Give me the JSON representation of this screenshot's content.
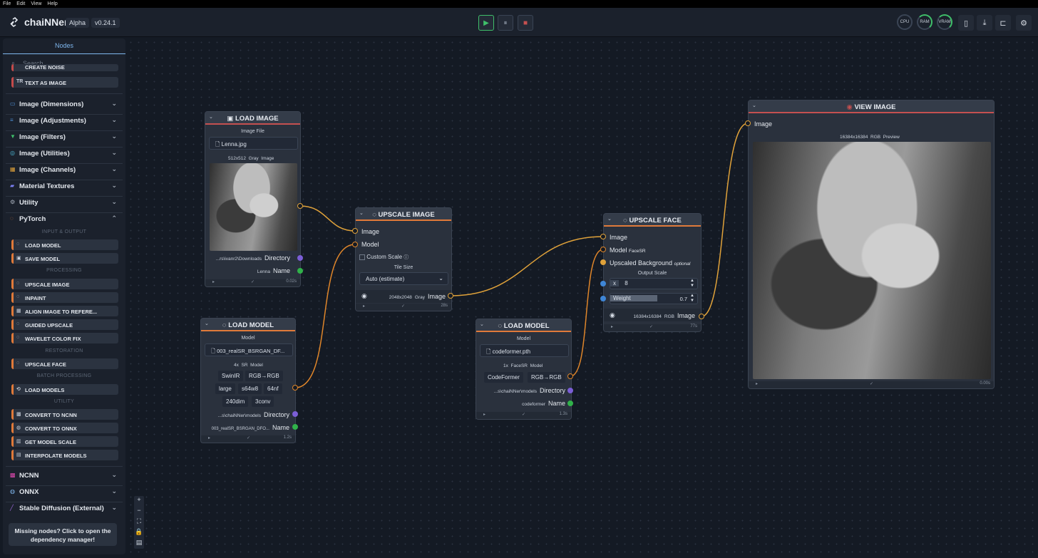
{
  "menubar": [
    "File",
    "Edit",
    "View",
    "Help"
  ],
  "app": {
    "title": "chaiNNer",
    "channel": "Alpha",
    "version": "v0.24.1"
  },
  "toolbar": {
    "run": "▶",
    "pause": "⏸",
    "stop": "■",
    "gauges": [
      "CPU",
      "RAM",
      "VRAM"
    ],
    "icons": [
      "bookmark-icon",
      "download-icon",
      "dependency-icon",
      "gear-icon"
    ]
  },
  "sidebar": {
    "tab": "Nodes",
    "search_placeholder": "Search...",
    "top_nodes": [
      "CREATE NOISE",
      "TEXT AS IMAGE"
    ],
    "categories": [
      {
        "label": "Image (Dimensions)",
        "icon": "▭",
        "color": "#4d8fd6"
      },
      {
        "label": "Image (Adjustments)",
        "icon": "≡",
        "color": "#4d8fd6"
      },
      {
        "label": "Image (Filters)",
        "icon": "▼",
        "color": "#3fbf6a"
      },
      {
        "label": "Image (Utilities)",
        "icon": "◎",
        "color": "#4db8d6"
      },
      {
        "label": "Image (Channels)",
        "icon": "▦",
        "color": "#e0a23a"
      },
      {
        "label": "Material Textures",
        "icon": "▰",
        "color": "#7b7ff0"
      },
      {
        "label": "Utility",
        "icon": "⚙",
        "color": "#aab2be"
      },
      {
        "label": "PyTorch",
        "icon": "◌",
        "color": "#e07a3a"
      }
    ],
    "pytorch": {
      "input_output": "INPUT & OUTPUT",
      "io_nodes": [
        "LOAD MODEL",
        "SAVE MODEL"
      ],
      "processing": "PROCESSING",
      "proc_nodes": [
        "UPSCALE IMAGE",
        "INPAINT",
        "ALIGN IMAGE TO REFERE...",
        "GUIDED UPSCALE",
        "WAVELET COLOR FIX"
      ],
      "restoration": "RESTORATION",
      "rest_nodes": [
        "UPSCALE FACE"
      ],
      "batch": "BATCH PROCESSING",
      "batch_nodes": [
        "LOAD MODELS"
      ],
      "utility": "UTILITY",
      "util_nodes": [
        "CONVERT TO NCNN",
        "CONVERT TO ONNX",
        "GET MODEL SCALE",
        "INTERPOLATE MODELS"
      ]
    },
    "bottom_categories": [
      {
        "label": "NCNN",
        "icon": "▩",
        "color": "#e04ab0"
      },
      {
        "label": "ONNX",
        "icon": "◍",
        "color": "#7fb7ee"
      },
      {
        "label": "Stable Diffusion (External)",
        "icon": "╱",
        "color": "#a06ae0"
      }
    ],
    "missing": "Missing nodes? Click to open the dependency manager!"
  },
  "zoom_controls": [
    "+",
    "−",
    "⛶",
    "🔒",
    "▤"
  ],
  "nodes": {
    "load_image": {
      "title": "LOAD IMAGE",
      "file_label": "Image File",
      "file": "Lenna.jpg",
      "dims": "512x512",
      "mode": "Gray",
      "type": "Image",
      "dir_value": "...rs\\ivanr2\\Downloads",
      "dir_label": "Directory",
      "name_value": "Lenna",
      "name_label": "Name",
      "time": "0.02s"
    },
    "load_model_1": {
      "title": "LOAD MODEL",
      "model_label": "Model",
      "file": "003_realSR_BSRGAN_DF...",
      "scale": "4x",
      "arch": "SR",
      "type": "Model",
      "tags": [
        "SwinIR",
        "RGB→RGB",
        "large",
        "s64w8",
        "64nf",
        "240dim",
        "3conv"
      ],
      "dir_value": "...s\\chaiNNer\\models",
      "dir_label": "Directory",
      "name_value": "003_realSR_BSRGAN_DFO...",
      "name_label": "Name",
      "time": "1.2s"
    },
    "upscale_image": {
      "title": "UPSCALE IMAGE",
      "in_image": "Image",
      "in_model": "Model",
      "custom_scale": "Custom Scale",
      "tile_label": "Tile Size",
      "tile_value": "Auto (estimate)",
      "dims": "2048x2048",
      "mode": "Gray",
      "out_label": "Image",
      "time": "28s"
    },
    "load_model_2": {
      "title": "LOAD MODEL",
      "model_label": "Model",
      "file": "codeformer.pth",
      "scale": "1x",
      "arch": "FaceSR",
      "type": "Model",
      "tags": [
        "CodeFormer",
        "RGB→RGB"
      ],
      "dir_value": "...s\\chaiNNer\\models",
      "dir_label": "Directory",
      "name_value": "codeformer",
      "name_label": "Name",
      "time": "1.3s"
    },
    "upscale_face": {
      "title": "UPSCALE FACE",
      "in_image": "Image",
      "in_model": "Model",
      "model_tag": "FaceSR",
      "bg_label": "Upscaled Background",
      "optional": "optional",
      "scale_label": "Output Scale",
      "x": "x",
      "scale_value": "8",
      "weight_label": "Weight",
      "weight_value": "0.7",
      "dims": "16384x16384",
      "mode": "RGB",
      "out_label": "Image",
      "time": "77s"
    },
    "view_image": {
      "title": "VIEW IMAGE",
      "in_image": "Image",
      "dims": "16384x16384",
      "mode": "RGB",
      "preview": "Preview",
      "time": "0.00s"
    }
  },
  "colors": {
    "accent": "#7fb7ee",
    "io": "#c55050",
    "pytorch": "#e07a3a",
    "image_port": "#e0a23a",
    "dir_port": "#7b5ed6",
    "name_port": "#30b24a",
    "num_port": "#3f86d6"
  }
}
